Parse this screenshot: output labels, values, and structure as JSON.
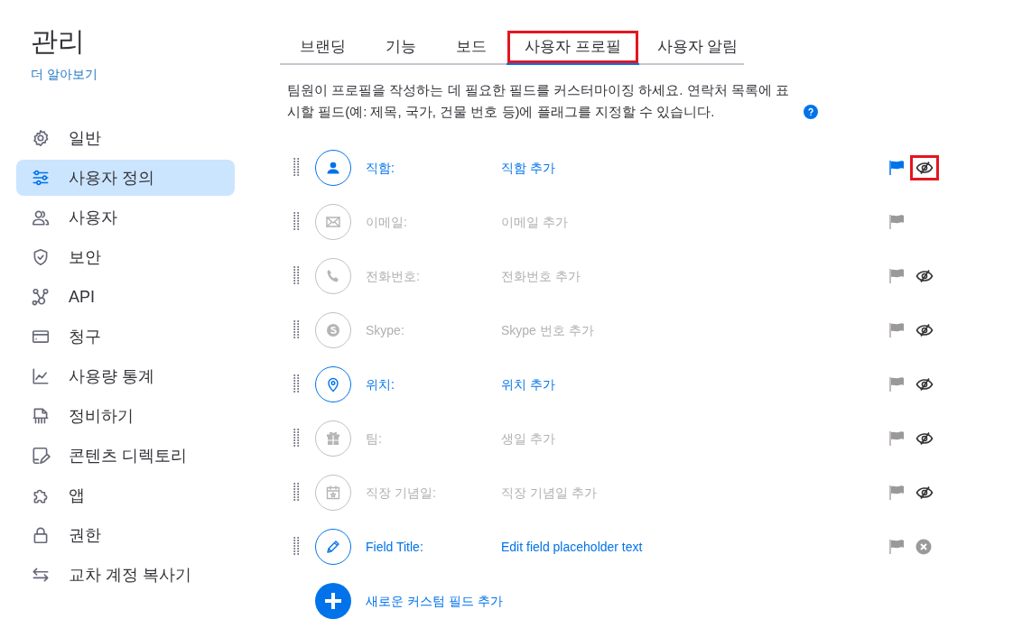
{
  "sidebar": {
    "title": "관리",
    "learn_more": "더 알아보기",
    "items": [
      {
        "label": "일반",
        "selected": false
      },
      {
        "label": "사용자 정의",
        "selected": true
      },
      {
        "label": "사용자",
        "selected": false
      },
      {
        "label": "보안",
        "selected": false
      },
      {
        "label": "API",
        "selected": false
      },
      {
        "label": "청구",
        "selected": false
      },
      {
        "label": "사용량 통계",
        "selected": false
      },
      {
        "label": "정비하기",
        "selected": false
      },
      {
        "label": "콘텐츠 디렉토리",
        "selected": false
      },
      {
        "label": "앱",
        "selected": false
      },
      {
        "label": "권한",
        "selected": false
      },
      {
        "label": "교차 계정 복사기",
        "selected": false
      }
    ]
  },
  "tabs": [
    {
      "label": "브랜딩",
      "selected": false,
      "highlighted": false
    },
    {
      "label": "기능",
      "selected": false,
      "highlighted": false
    },
    {
      "label": "보드",
      "selected": false,
      "highlighted": false
    },
    {
      "label": "사용자 프로필",
      "selected": true,
      "highlighted": true
    },
    {
      "label": "사용자 알림",
      "selected": false,
      "highlighted": false
    }
  ],
  "description": "팀원이 프로필을 작성하는 데 필요한 필드를 커스터마이징 하세요. 연락처 목록에 표시할 필드(예: 제목, 국가, 건물 번호 등)에 플래그를 지정할 수 있습니다.",
  "fields": [
    {
      "kind": "hideable",
      "label": "직함:",
      "placeholder": "직함 추가",
      "active": true,
      "flagged": true,
      "highlighted": true
    },
    {
      "kind": "fixed",
      "label": "이메일:",
      "placeholder": "이메일 추가",
      "active": false,
      "flagged": false,
      "highlighted": false
    },
    {
      "kind": "hideable",
      "label": "전화번호:",
      "placeholder": "전화번호 추가",
      "active": false,
      "flagged": false,
      "highlighted": false
    },
    {
      "kind": "hideable",
      "label": "Skype:",
      "placeholder": "Skype 번호 추가",
      "active": false,
      "flagged": false,
      "highlighted": false
    },
    {
      "kind": "hideable",
      "label": "위치:",
      "placeholder": "위치 추가",
      "active": true,
      "flagged": false,
      "highlighted": false
    },
    {
      "kind": "hideable",
      "label": "팀:",
      "placeholder": "생일 추가",
      "active": false,
      "flagged": false,
      "highlighted": false
    },
    {
      "kind": "hideable",
      "label": "직장 기념일:",
      "placeholder": "직장 기념일 추가",
      "active": false,
      "flagged": false,
      "highlighted": false
    },
    {
      "kind": "custom",
      "label": "Field Title:",
      "placeholder": "Edit field placeholder text",
      "active": true,
      "flagged": false,
      "highlighted": false
    }
  ],
  "add_field": "새로운 커스텀 필드 추가"
}
